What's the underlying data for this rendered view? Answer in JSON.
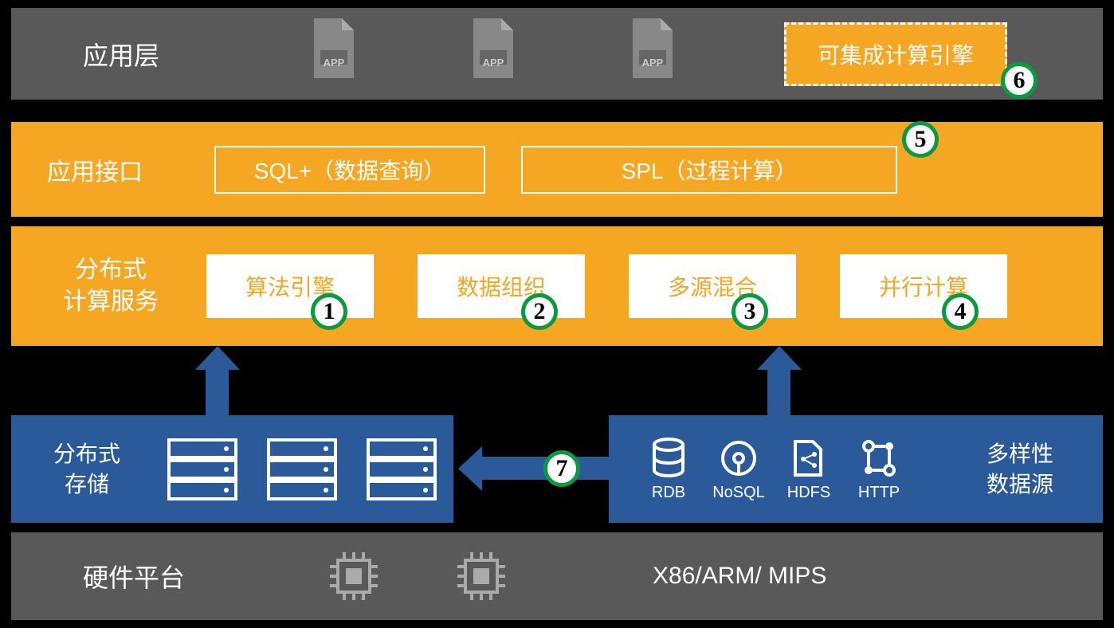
{
  "layers": {
    "application": {
      "title": "应用层",
      "engine_box": "可集成计算引擎",
      "app_label": "APP"
    },
    "interface": {
      "title": "应用接口",
      "box1": "SQL+（数据查询）",
      "box2": "SPL（过程计算）"
    },
    "compute": {
      "title_line1": "分布式",
      "title_line2": "计算服务",
      "boxes": [
        "算法引擎",
        "数据组织",
        "多源混合",
        "并行计算"
      ]
    },
    "storage": {
      "title_line1": "分布式",
      "title_line2": "存储"
    },
    "datasource": {
      "title_line1": "多样性",
      "title_line2": "数据源",
      "items": [
        "RDB",
        "NoSQL",
        "HDFS",
        "HTTP"
      ]
    },
    "hardware": {
      "title": "硬件平台",
      "text": "X86/ARM/ MIPS"
    }
  },
  "badges": {
    "b1": "1",
    "b2": "2",
    "b3": "3",
    "b4": "4",
    "b5": "5",
    "b6": "6",
    "b7": "7"
  }
}
